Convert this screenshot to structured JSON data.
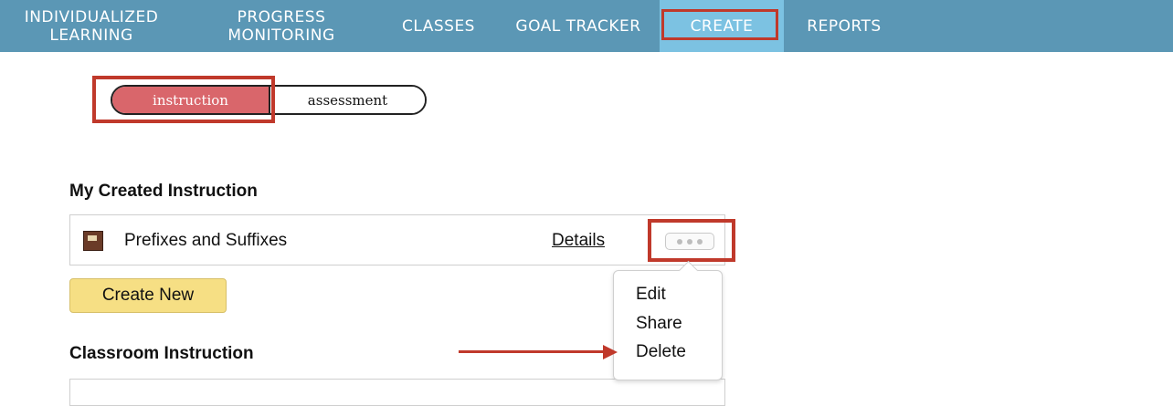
{
  "nav": {
    "items": [
      {
        "id": "individualized",
        "line1": "INDIVIDUALIZED",
        "line2": "LEARNING"
      },
      {
        "id": "progress",
        "line1": "PROGRESS",
        "line2": "MONITORING"
      },
      {
        "id": "classes",
        "label": "CLASSES"
      },
      {
        "id": "goal",
        "label": "GOAL TRACKER"
      },
      {
        "id": "create",
        "label": "CREATE",
        "active": true
      },
      {
        "id": "reports",
        "label": "REPORTS"
      }
    ]
  },
  "toggle": {
    "options": [
      "instruction",
      "assessment"
    ],
    "selected": "instruction"
  },
  "my_created": {
    "title": "My Created Instruction",
    "items": [
      {
        "title": "Prefixes and Suffixes",
        "details_label": "Details",
        "thumbnail_icon": "lesson-thumbnail-icon"
      }
    ],
    "create_label": "Create New"
  },
  "more_menu": {
    "items": [
      "Edit",
      "Share",
      "Delete"
    ]
  },
  "classroom": {
    "title": "Classroom Instruction"
  },
  "colors": {
    "nav_bg": "#5b97b5",
    "nav_active": "#7cc2e2",
    "toggle_selected": "#d9666b",
    "create_button": "#f6df84",
    "highlight": "#c0392b"
  }
}
